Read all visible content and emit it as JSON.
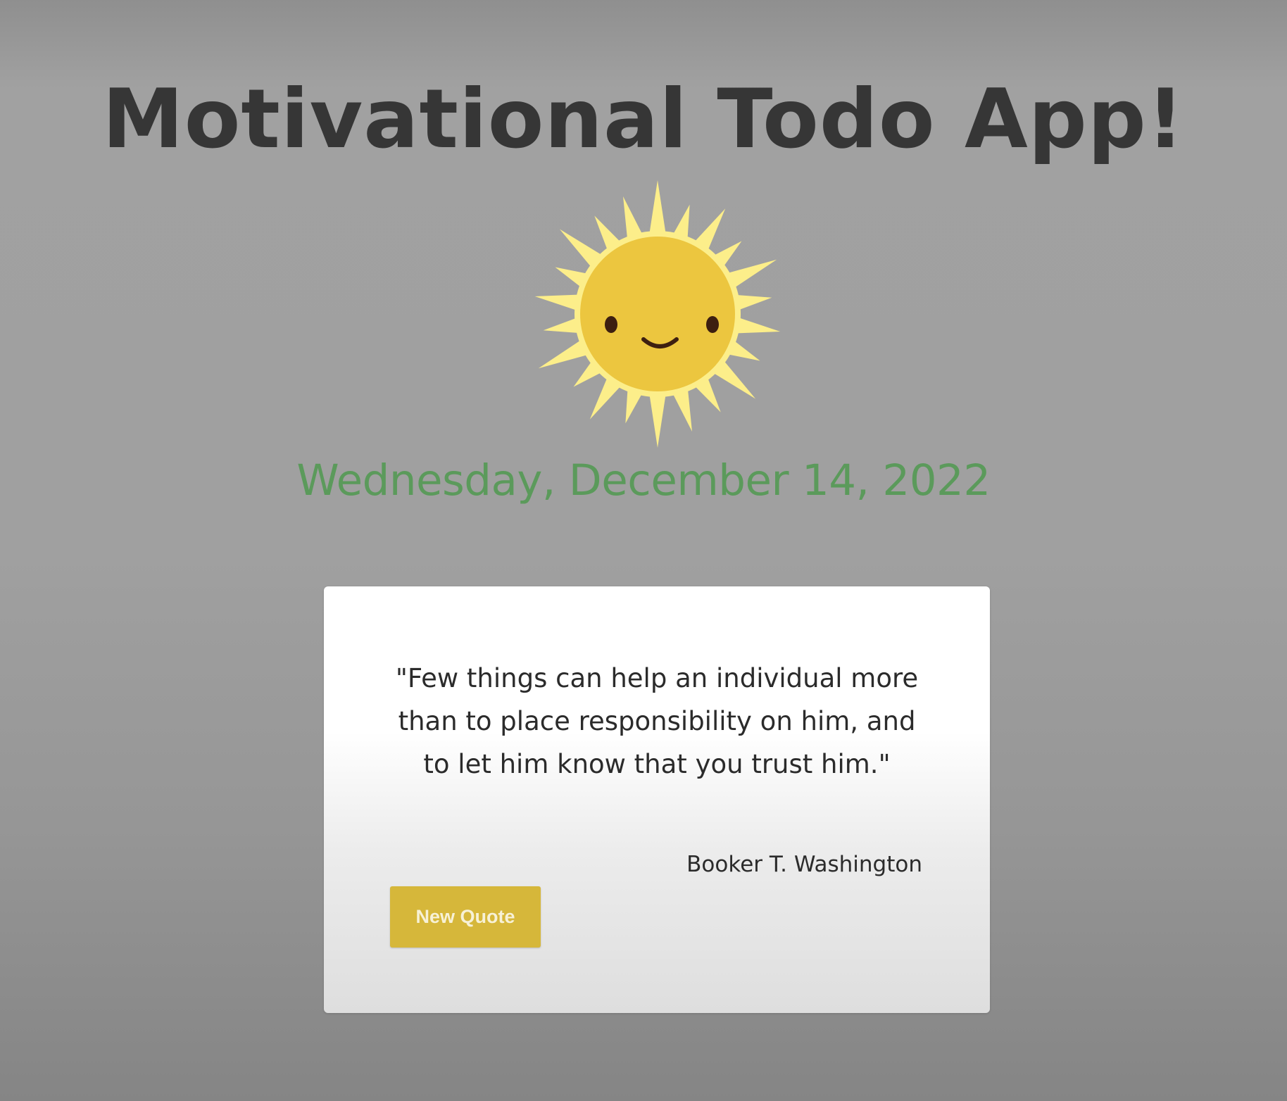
{
  "app": {
    "title": "Motivational Todo App!",
    "date": "Wednesday, December 14, 2022"
  },
  "sun": {
    "icon": "smiling-sun-icon",
    "colors": {
      "rays": "#fcee8a",
      "face": "#ecc63f",
      "features": "#3d1f10"
    }
  },
  "quote": {
    "text": "\"Few things can help an individual more than to place responsibility on him, and to let him know that you trust him.\"",
    "author": "Booker T. Washington",
    "button_label": "New Quote"
  },
  "colors": {
    "title": "#363636",
    "date": "#5b9a5b",
    "button": "#d6b73a",
    "button_text": "#f7f1d6"
  }
}
